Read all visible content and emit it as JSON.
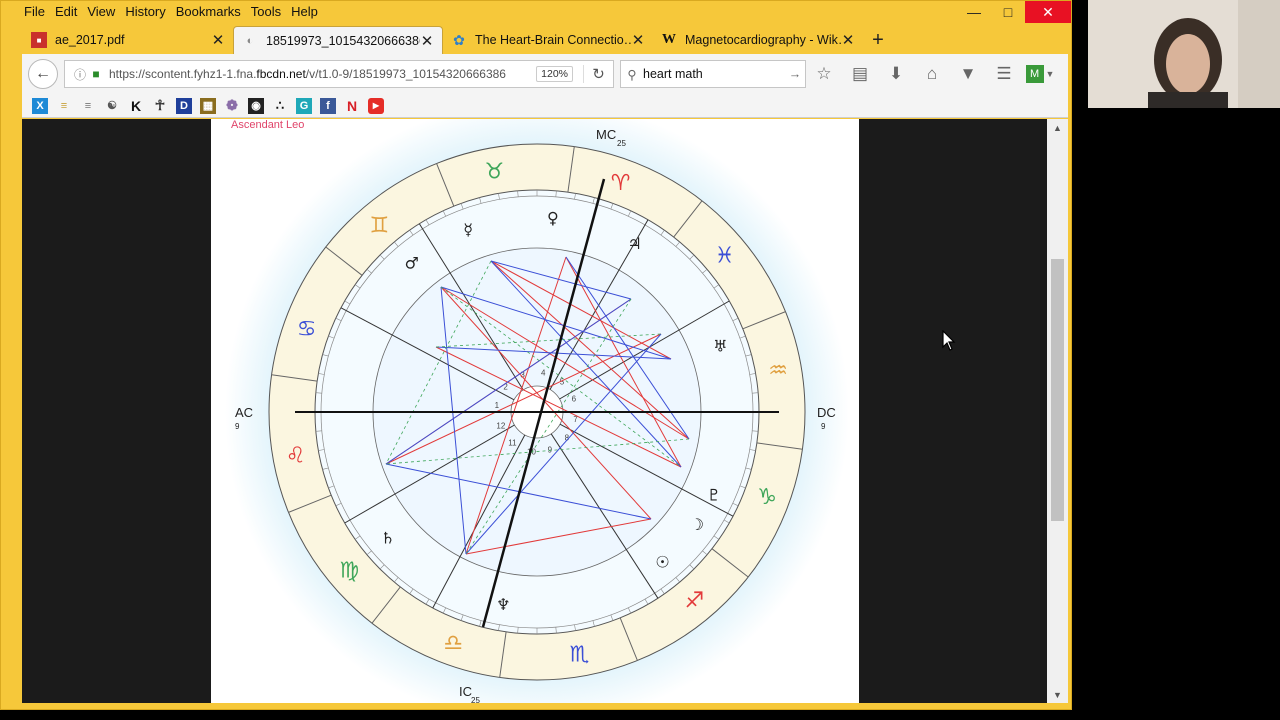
{
  "menu": [
    "File",
    "Edit",
    "View",
    "History",
    "Bookmarks",
    "Tools",
    "Help"
  ],
  "tabs": [
    {
      "label": "ae_2017.pdf",
      "icon": "pdf-icon"
    },
    {
      "label": "18519973_101543206663866…",
      "icon": "image-icon"
    },
    {
      "label": "The Heart-Brain Connectio…",
      "icon": "heartmath-icon"
    },
    {
      "label": "Magnetocardiography - Wik…",
      "icon": "wikipedia-icon"
    }
  ],
  "url": {
    "prefix": "https://scontent.fyhz1-1.fna.",
    "domain": "fbcdn.net",
    "path": "/v/t1.0-9/18519973_10154320666386",
    "zoom": "120%"
  },
  "search": {
    "query": "heart math"
  },
  "chart": {
    "ascendant_label": "Ascendant Leo",
    "mc": "MC",
    "mc_deg": "25",
    "ic": "IC",
    "ic_deg": "25",
    "ac": "AC",
    "ac_deg": "9",
    "dc": "DC",
    "dc_deg": "9",
    "house_numbers": [
      "1",
      "2",
      "3",
      "4",
      "5",
      "6",
      "7",
      "8",
      "9",
      "10",
      "11",
      "12"
    ]
  },
  "colors": {
    "window_frame": "#f6c83a",
    "close_button": "#e81123",
    "red_aspect": "#e23a3a",
    "blue_aspect": "#3b4fd6",
    "green_aspect": "#3fa65a"
  }
}
